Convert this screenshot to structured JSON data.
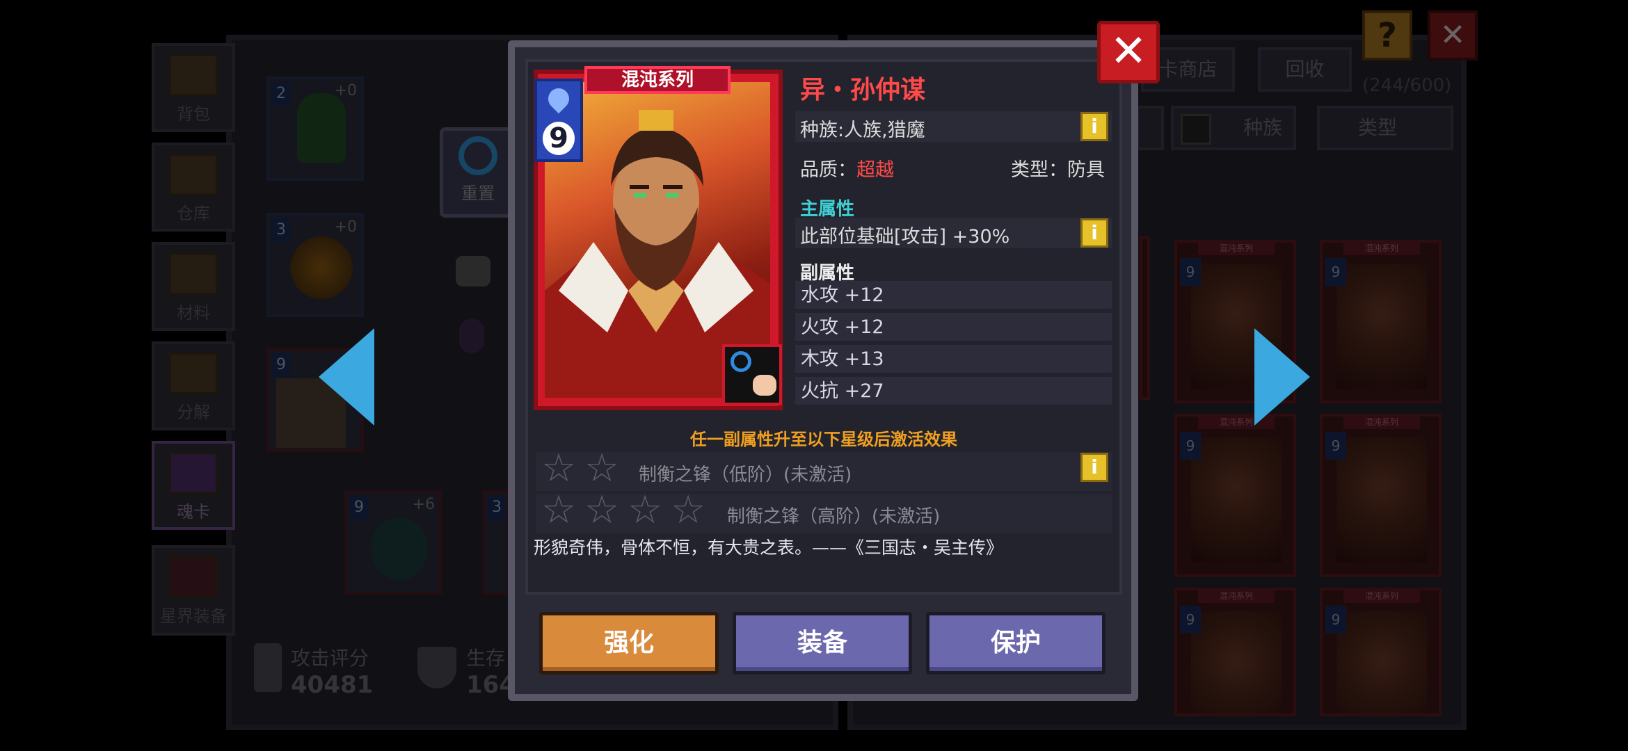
{
  "top_right": {
    "help_label": "?",
    "close_label": "✕"
  },
  "sidebar": {
    "items": [
      {
        "label": "背包"
      },
      {
        "label": "仓库"
      },
      {
        "label": "材料"
      },
      {
        "label": "分解"
      },
      {
        "label": "魂卡"
      },
      {
        "label": "星界装备"
      }
    ]
  },
  "left_grid": {
    "cards": [
      {
        "level": "2",
        "plus": "+0"
      },
      {
        "level": "3",
        "plus": "+0"
      },
      {
        "level": "9",
        "plus": ""
      },
      {
        "level": "9",
        "plus": "+6"
      },
      {
        "level": "3",
        "plus": ""
      }
    ],
    "reset_label": "重置"
  },
  "scores": {
    "attack_label": "攻击评分",
    "attack_value": "40481",
    "survival_label": "生存",
    "survival_value": "164"
  },
  "right_panel": {
    "shop_label": "卡商店",
    "recycle_label": "回收",
    "capacity": "(244/600)",
    "filters": [
      {
        "label": "种族"
      },
      {
        "label": "类型"
      }
    ],
    "card_tag": "混沌系列",
    "card_levels": [
      "9",
      "9",
      "9",
      "9",
      "9",
      "9"
    ]
  },
  "detail": {
    "series": "混沌系列",
    "cost": "9",
    "name": "异・孙仲谋",
    "race": "种族:人族,猎魔",
    "quality_label": "品质：",
    "quality_value": "超越",
    "type_label": "类型：",
    "type_value": "防具",
    "main_attr_title": "主属性",
    "main_attr": "此部位基础[攻击] +30%",
    "sub_attr_title": "副属性",
    "sub_attrs": [
      "水攻 +12",
      "火攻 +12",
      "木攻 +13",
      "火抗 +27"
    ],
    "effect_title": "任一副属性升至以下星级后激活效果",
    "effects": [
      {
        "stars": 2,
        "text": "制衡之锋（低阶）(未激活)"
      },
      {
        "stars": 4,
        "text": "制衡之锋（高阶）(未激活)"
      }
    ],
    "quote": "形貌奇伟，骨体不恒，有大贵之表。——《三国志・吴主传》",
    "info_label": "i",
    "close_label": "✕"
  },
  "actions": {
    "enhance": "强化",
    "equip": "装备",
    "protect": "保护"
  },
  "colors": {
    "name_red": "#ff4a4a",
    "quality_red": "#ff4a4a",
    "section_cyan": "#3fd1d6",
    "effect_orange": "#f0a020",
    "enhance_orange": "#d98a3a",
    "equip_purple": "#6b68ad",
    "arrow_blue": "#3ba9e0"
  }
}
